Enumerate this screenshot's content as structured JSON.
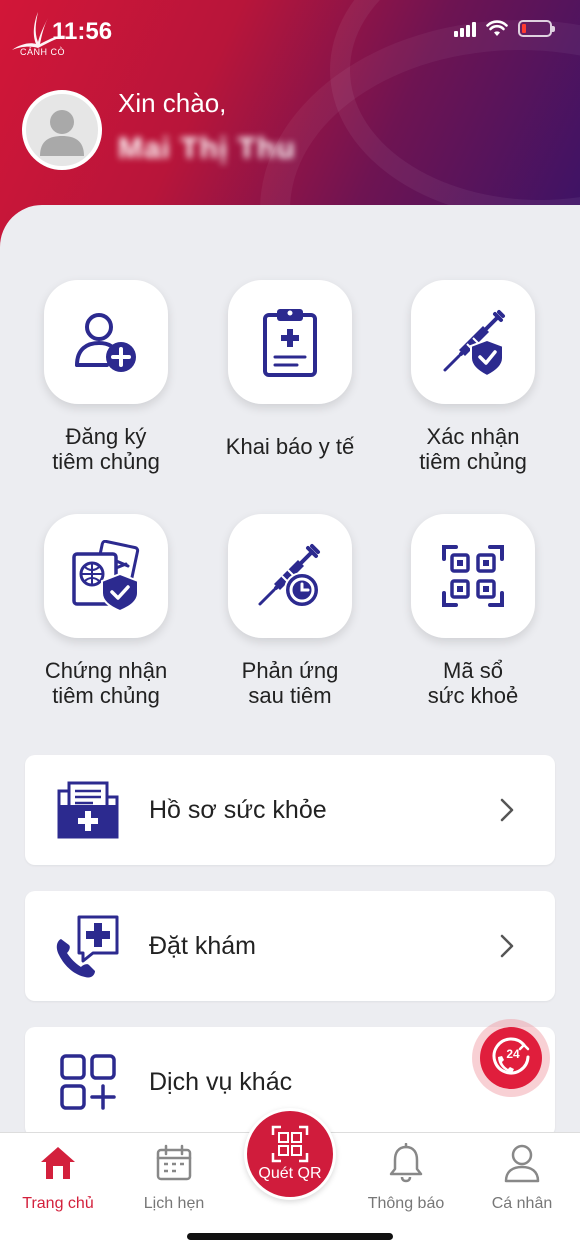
{
  "status": {
    "time": "11:56",
    "logo_text": "CÁNH CÒ"
  },
  "header": {
    "greeting": "Xin chào,",
    "username": "Mai Thị Thu"
  },
  "grid": [
    {
      "label": "Đăng ký\ntiêm chủng",
      "icon": "user-add-icon"
    },
    {
      "label": "Khai báo y tế",
      "icon": "medical-clipboard-icon"
    },
    {
      "label": "Xác nhận\ntiêm chủng",
      "icon": "vaccine-shield-icon"
    },
    {
      "label": "Chứng nhận\ntiêm chủng",
      "icon": "passport-certificate-icon"
    },
    {
      "label": "Phản ứng\nsau tiêm",
      "icon": "vaccine-clock-icon"
    },
    {
      "label": "Mã sổ\nsức khoẻ",
      "icon": "qr-code-icon"
    }
  ],
  "cards": [
    {
      "label": "Hồ sơ sức khỏe",
      "icon": "health-records-icon"
    },
    {
      "label": "Đặt khám",
      "icon": "phone-medical-icon"
    },
    {
      "label": "Dịch vụ khác",
      "icon": "apps-icon"
    }
  ],
  "hotline": {
    "label": "24"
  },
  "tabs": [
    {
      "label": "Trang chủ",
      "icon": "home-icon",
      "active": true
    },
    {
      "label": "Lịch hẹn",
      "icon": "calendar-icon",
      "active": false
    },
    {
      "label": "Quét QR",
      "icon": "qr-scan-icon",
      "active": false
    },
    {
      "label": "Thông báo",
      "icon": "bell-icon",
      "active": false
    },
    {
      "label": "Cá nhân",
      "icon": "user-icon",
      "active": false
    }
  ],
  "colors": {
    "primary": "#2c2a8f",
    "accent": "#d01c3c",
    "header_start": "#d21638",
    "header_end": "#3a1367"
  }
}
